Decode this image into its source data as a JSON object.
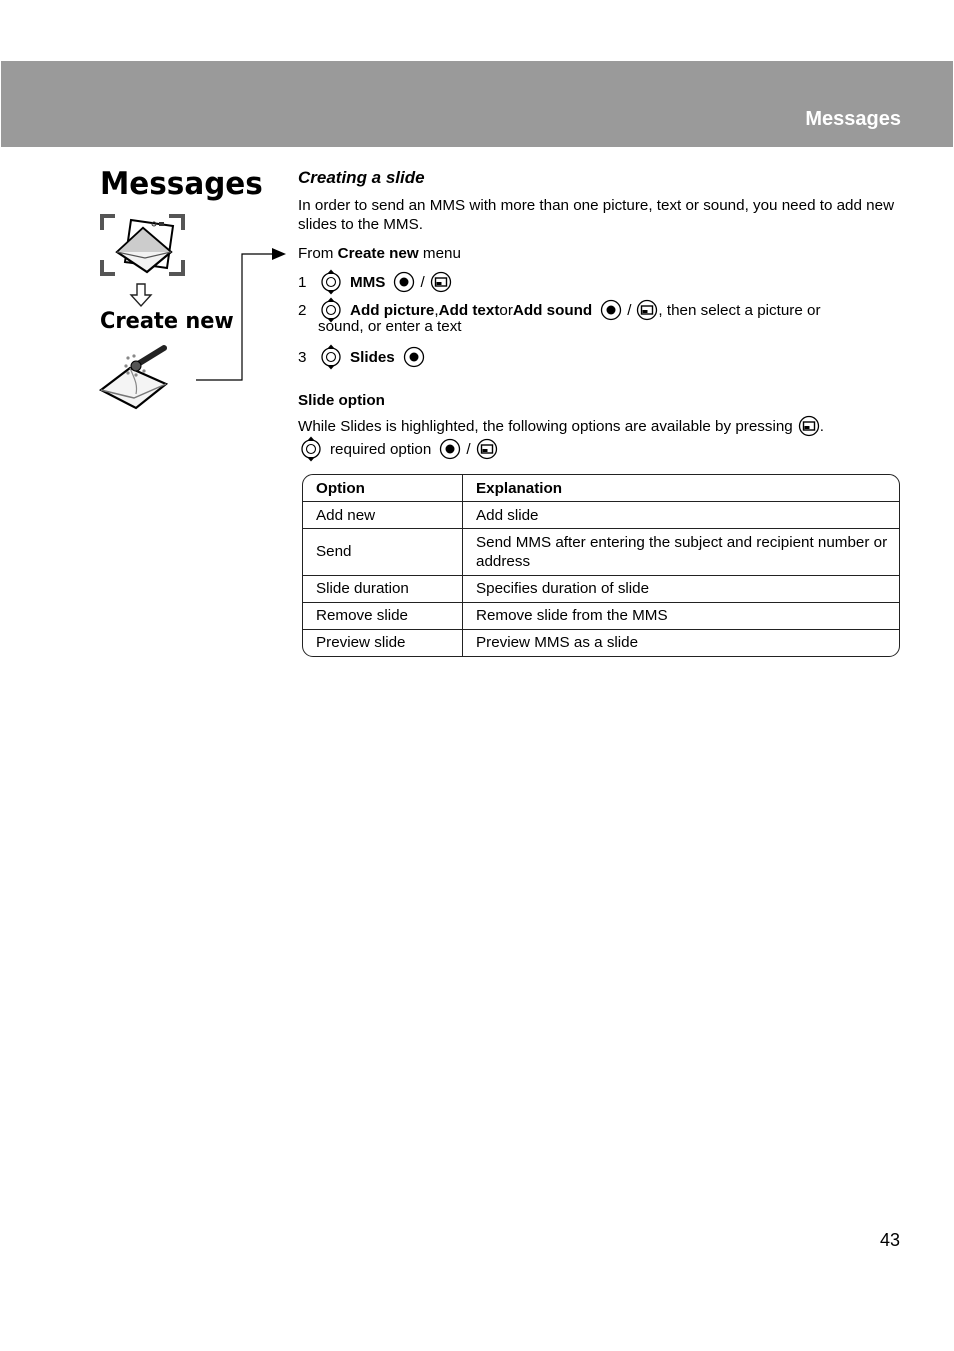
{
  "header": {
    "title": "Messages",
    "band_color": "#9a9a9a"
  },
  "sidebar": {
    "section_title": "Messages",
    "menu_icon": "messages-envelope-icon",
    "arrow_icon": "down-arrow-icon",
    "sub_title": "Create new",
    "sub_icon": "create-new-envelope-icon"
  },
  "content": {
    "heading": "Creating a slide",
    "intro": "In order to send an MMS with more than one picture, text or sound, you need to add new slides to the MMS.",
    "from": {
      "prefix": "From ",
      "menu": "Create new",
      "suffix": " menu"
    },
    "steps": [
      {
        "num": "1",
        "parts": [
          {
            "text": "MMS",
            "bold": true
          }
        ],
        "confirm": true,
        "menu_key": true
      },
      {
        "num": "2",
        "parts": [
          {
            "text": "Add picture",
            "bold": true
          },
          {
            "text": ", ",
            "bold": false
          },
          {
            "text": "Add text",
            "bold": true
          },
          {
            "text": " or ",
            "bold": false
          },
          {
            "text": "Add sound",
            "bold": true
          }
        ],
        "confirm": true,
        "menu_key": true,
        "after": ", then select a picture or",
        "continuation": "sound, or enter a text"
      },
      {
        "num": "3",
        "parts": [
          {
            "text": "Slides",
            "bold": true
          }
        ],
        "confirm": true,
        "menu_key": false
      }
    ],
    "slide_option": {
      "title": "Slide option",
      "text": "While Slides is highlighted, the following options are available by pressing",
      "text_end": ".",
      "line": "required option"
    },
    "separator": "/",
    "icons": {
      "nav": "navigation-key-icon",
      "confirm": "center-select-key-icon",
      "menu": "menu-softkey-icon"
    }
  },
  "table": {
    "headers": [
      "Option",
      "Explanation"
    ],
    "rows": [
      [
        "Add new",
        "Add slide"
      ],
      [
        "Send",
        "Send MMS after entering the subject and recipient number or address"
      ],
      [
        "Slide duration",
        "Specifies duration of slide"
      ],
      [
        "Remove slide",
        "Remove slide from the MMS"
      ],
      [
        "Preview slide",
        "Preview MMS as a slide"
      ]
    ]
  },
  "footer": {
    "page_number": "43"
  }
}
